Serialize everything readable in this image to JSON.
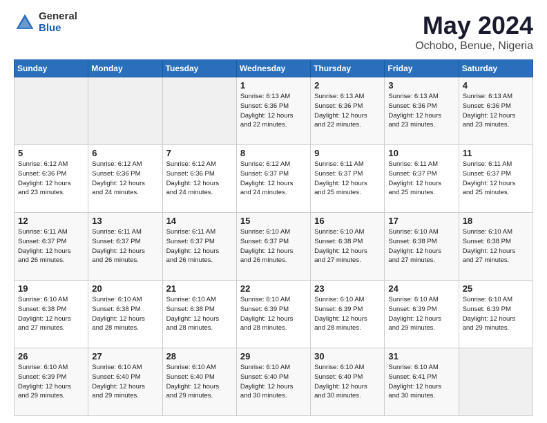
{
  "logo": {
    "general": "General",
    "blue": "Blue"
  },
  "header": {
    "title": "May 2024",
    "subtitle": "Ochobo, Benue, Nigeria"
  },
  "weekdays": [
    "Sunday",
    "Monday",
    "Tuesday",
    "Wednesday",
    "Thursday",
    "Friday",
    "Saturday"
  ],
  "weeks": [
    [
      {
        "day": "",
        "info": ""
      },
      {
        "day": "",
        "info": ""
      },
      {
        "day": "",
        "info": ""
      },
      {
        "day": "1",
        "info": "Sunrise: 6:13 AM\nSunset: 6:36 PM\nDaylight: 12 hours\nand 22 minutes."
      },
      {
        "day": "2",
        "info": "Sunrise: 6:13 AM\nSunset: 6:36 PM\nDaylight: 12 hours\nand 22 minutes."
      },
      {
        "day": "3",
        "info": "Sunrise: 6:13 AM\nSunset: 6:36 PM\nDaylight: 12 hours\nand 23 minutes."
      },
      {
        "day": "4",
        "info": "Sunrise: 6:13 AM\nSunset: 6:36 PM\nDaylight: 12 hours\nand 23 minutes."
      }
    ],
    [
      {
        "day": "5",
        "info": "Sunrise: 6:12 AM\nSunset: 6:36 PM\nDaylight: 12 hours\nand 23 minutes."
      },
      {
        "day": "6",
        "info": "Sunrise: 6:12 AM\nSunset: 6:36 PM\nDaylight: 12 hours\nand 24 minutes."
      },
      {
        "day": "7",
        "info": "Sunrise: 6:12 AM\nSunset: 6:36 PM\nDaylight: 12 hours\nand 24 minutes."
      },
      {
        "day": "8",
        "info": "Sunrise: 6:12 AM\nSunset: 6:37 PM\nDaylight: 12 hours\nand 24 minutes."
      },
      {
        "day": "9",
        "info": "Sunrise: 6:11 AM\nSunset: 6:37 PM\nDaylight: 12 hours\nand 25 minutes."
      },
      {
        "day": "10",
        "info": "Sunrise: 6:11 AM\nSunset: 6:37 PM\nDaylight: 12 hours\nand 25 minutes."
      },
      {
        "day": "11",
        "info": "Sunrise: 6:11 AM\nSunset: 6:37 PM\nDaylight: 12 hours\nand 25 minutes."
      }
    ],
    [
      {
        "day": "12",
        "info": "Sunrise: 6:11 AM\nSunset: 6:37 PM\nDaylight: 12 hours\nand 26 minutes."
      },
      {
        "day": "13",
        "info": "Sunrise: 6:11 AM\nSunset: 6:37 PM\nDaylight: 12 hours\nand 26 minutes."
      },
      {
        "day": "14",
        "info": "Sunrise: 6:11 AM\nSunset: 6:37 PM\nDaylight: 12 hours\nand 26 minutes."
      },
      {
        "day": "15",
        "info": "Sunrise: 6:10 AM\nSunset: 6:37 PM\nDaylight: 12 hours\nand 26 minutes."
      },
      {
        "day": "16",
        "info": "Sunrise: 6:10 AM\nSunset: 6:38 PM\nDaylight: 12 hours\nand 27 minutes."
      },
      {
        "day": "17",
        "info": "Sunrise: 6:10 AM\nSunset: 6:38 PM\nDaylight: 12 hours\nand 27 minutes."
      },
      {
        "day": "18",
        "info": "Sunrise: 6:10 AM\nSunset: 6:38 PM\nDaylight: 12 hours\nand 27 minutes."
      }
    ],
    [
      {
        "day": "19",
        "info": "Sunrise: 6:10 AM\nSunset: 6:38 PM\nDaylight: 12 hours\nand 27 minutes."
      },
      {
        "day": "20",
        "info": "Sunrise: 6:10 AM\nSunset: 6:38 PM\nDaylight: 12 hours\nand 28 minutes."
      },
      {
        "day": "21",
        "info": "Sunrise: 6:10 AM\nSunset: 6:38 PM\nDaylight: 12 hours\nand 28 minutes."
      },
      {
        "day": "22",
        "info": "Sunrise: 6:10 AM\nSunset: 6:39 PM\nDaylight: 12 hours\nand 28 minutes."
      },
      {
        "day": "23",
        "info": "Sunrise: 6:10 AM\nSunset: 6:39 PM\nDaylight: 12 hours\nand 28 minutes."
      },
      {
        "day": "24",
        "info": "Sunrise: 6:10 AM\nSunset: 6:39 PM\nDaylight: 12 hours\nand 29 minutes."
      },
      {
        "day": "25",
        "info": "Sunrise: 6:10 AM\nSunset: 6:39 PM\nDaylight: 12 hours\nand 29 minutes."
      }
    ],
    [
      {
        "day": "26",
        "info": "Sunrise: 6:10 AM\nSunset: 6:39 PM\nDaylight: 12 hours\nand 29 minutes."
      },
      {
        "day": "27",
        "info": "Sunrise: 6:10 AM\nSunset: 6:40 PM\nDaylight: 12 hours\nand 29 minutes."
      },
      {
        "day": "28",
        "info": "Sunrise: 6:10 AM\nSunset: 6:40 PM\nDaylight: 12 hours\nand 29 minutes."
      },
      {
        "day": "29",
        "info": "Sunrise: 6:10 AM\nSunset: 6:40 PM\nDaylight: 12 hours\nand 30 minutes."
      },
      {
        "day": "30",
        "info": "Sunrise: 6:10 AM\nSunset: 6:40 PM\nDaylight: 12 hours\nand 30 minutes."
      },
      {
        "day": "31",
        "info": "Sunrise: 6:10 AM\nSunset: 6:41 PM\nDaylight: 12 hours\nand 30 minutes."
      },
      {
        "day": "",
        "info": ""
      }
    ]
  ]
}
